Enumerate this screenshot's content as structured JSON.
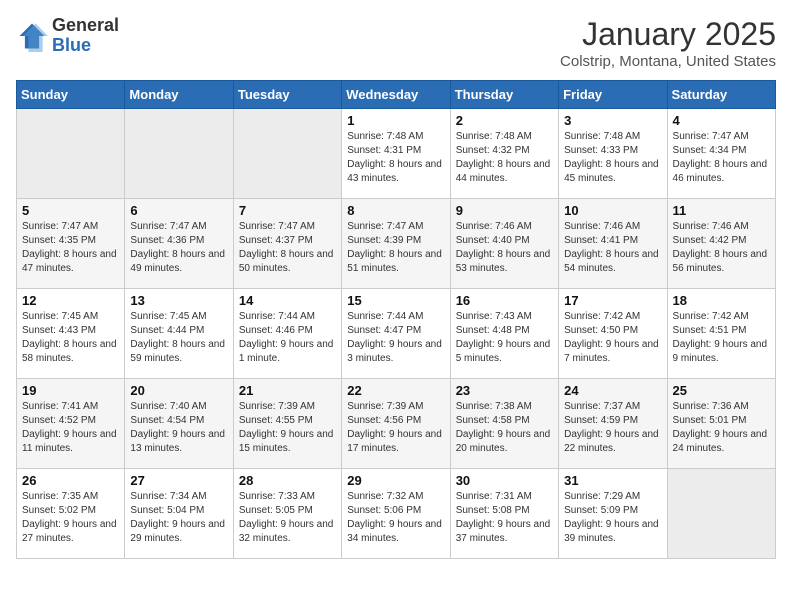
{
  "header": {
    "logo_general": "General",
    "logo_blue": "Blue",
    "title": "January 2025",
    "subtitle": "Colstrip, Montana, United States"
  },
  "days_of_week": [
    "Sunday",
    "Monday",
    "Tuesday",
    "Wednesday",
    "Thursday",
    "Friday",
    "Saturday"
  ],
  "weeks": [
    [
      {
        "day": "",
        "info": ""
      },
      {
        "day": "",
        "info": ""
      },
      {
        "day": "",
        "info": ""
      },
      {
        "day": "1",
        "info": "Sunrise: 7:48 AM\nSunset: 4:31 PM\nDaylight: 8 hours and 43 minutes."
      },
      {
        "day": "2",
        "info": "Sunrise: 7:48 AM\nSunset: 4:32 PM\nDaylight: 8 hours and 44 minutes."
      },
      {
        "day": "3",
        "info": "Sunrise: 7:48 AM\nSunset: 4:33 PM\nDaylight: 8 hours and 45 minutes."
      },
      {
        "day": "4",
        "info": "Sunrise: 7:47 AM\nSunset: 4:34 PM\nDaylight: 8 hours and 46 minutes."
      }
    ],
    [
      {
        "day": "5",
        "info": "Sunrise: 7:47 AM\nSunset: 4:35 PM\nDaylight: 8 hours and 47 minutes."
      },
      {
        "day": "6",
        "info": "Sunrise: 7:47 AM\nSunset: 4:36 PM\nDaylight: 8 hours and 49 minutes."
      },
      {
        "day": "7",
        "info": "Sunrise: 7:47 AM\nSunset: 4:37 PM\nDaylight: 8 hours and 50 minutes."
      },
      {
        "day": "8",
        "info": "Sunrise: 7:47 AM\nSunset: 4:39 PM\nDaylight: 8 hours and 51 minutes."
      },
      {
        "day": "9",
        "info": "Sunrise: 7:46 AM\nSunset: 4:40 PM\nDaylight: 8 hours and 53 minutes."
      },
      {
        "day": "10",
        "info": "Sunrise: 7:46 AM\nSunset: 4:41 PM\nDaylight: 8 hours and 54 minutes."
      },
      {
        "day": "11",
        "info": "Sunrise: 7:46 AM\nSunset: 4:42 PM\nDaylight: 8 hours and 56 minutes."
      }
    ],
    [
      {
        "day": "12",
        "info": "Sunrise: 7:45 AM\nSunset: 4:43 PM\nDaylight: 8 hours and 58 minutes."
      },
      {
        "day": "13",
        "info": "Sunrise: 7:45 AM\nSunset: 4:44 PM\nDaylight: 8 hours and 59 minutes."
      },
      {
        "day": "14",
        "info": "Sunrise: 7:44 AM\nSunset: 4:46 PM\nDaylight: 9 hours and 1 minute."
      },
      {
        "day": "15",
        "info": "Sunrise: 7:44 AM\nSunset: 4:47 PM\nDaylight: 9 hours and 3 minutes."
      },
      {
        "day": "16",
        "info": "Sunrise: 7:43 AM\nSunset: 4:48 PM\nDaylight: 9 hours and 5 minutes."
      },
      {
        "day": "17",
        "info": "Sunrise: 7:42 AM\nSunset: 4:50 PM\nDaylight: 9 hours and 7 minutes."
      },
      {
        "day": "18",
        "info": "Sunrise: 7:42 AM\nSunset: 4:51 PM\nDaylight: 9 hours and 9 minutes."
      }
    ],
    [
      {
        "day": "19",
        "info": "Sunrise: 7:41 AM\nSunset: 4:52 PM\nDaylight: 9 hours and 11 minutes."
      },
      {
        "day": "20",
        "info": "Sunrise: 7:40 AM\nSunset: 4:54 PM\nDaylight: 9 hours and 13 minutes."
      },
      {
        "day": "21",
        "info": "Sunrise: 7:39 AM\nSunset: 4:55 PM\nDaylight: 9 hours and 15 minutes."
      },
      {
        "day": "22",
        "info": "Sunrise: 7:39 AM\nSunset: 4:56 PM\nDaylight: 9 hours and 17 minutes."
      },
      {
        "day": "23",
        "info": "Sunrise: 7:38 AM\nSunset: 4:58 PM\nDaylight: 9 hours and 20 minutes."
      },
      {
        "day": "24",
        "info": "Sunrise: 7:37 AM\nSunset: 4:59 PM\nDaylight: 9 hours and 22 minutes."
      },
      {
        "day": "25",
        "info": "Sunrise: 7:36 AM\nSunset: 5:01 PM\nDaylight: 9 hours and 24 minutes."
      }
    ],
    [
      {
        "day": "26",
        "info": "Sunrise: 7:35 AM\nSunset: 5:02 PM\nDaylight: 9 hours and 27 minutes."
      },
      {
        "day": "27",
        "info": "Sunrise: 7:34 AM\nSunset: 5:04 PM\nDaylight: 9 hours and 29 minutes."
      },
      {
        "day": "28",
        "info": "Sunrise: 7:33 AM\nSunset: 5:05 PM\nDaylight: 9 hours and 32 minutes."
      },
      {
        "day": "29",
        "info": "Sunrise: 7:32 AM\nSunset: 5:06 PM\nDaylight: 9 hours and 34 minutes."
      },
      {
        "day": "30",
        "info": "Sunrise: 7:31 AM\nSunset: 5:08 PM\nDaylight: 9 hours and 37 minutes."
      },
      {
        "day": "31",
        "info": "Sunrise: 7:29 AM\nSunset: 5:09 PM\nDaylight: 9 hours and 39 minutes."
      },
      {
        "day": "",
        "info": ""
      }
    ]
  ]
}
